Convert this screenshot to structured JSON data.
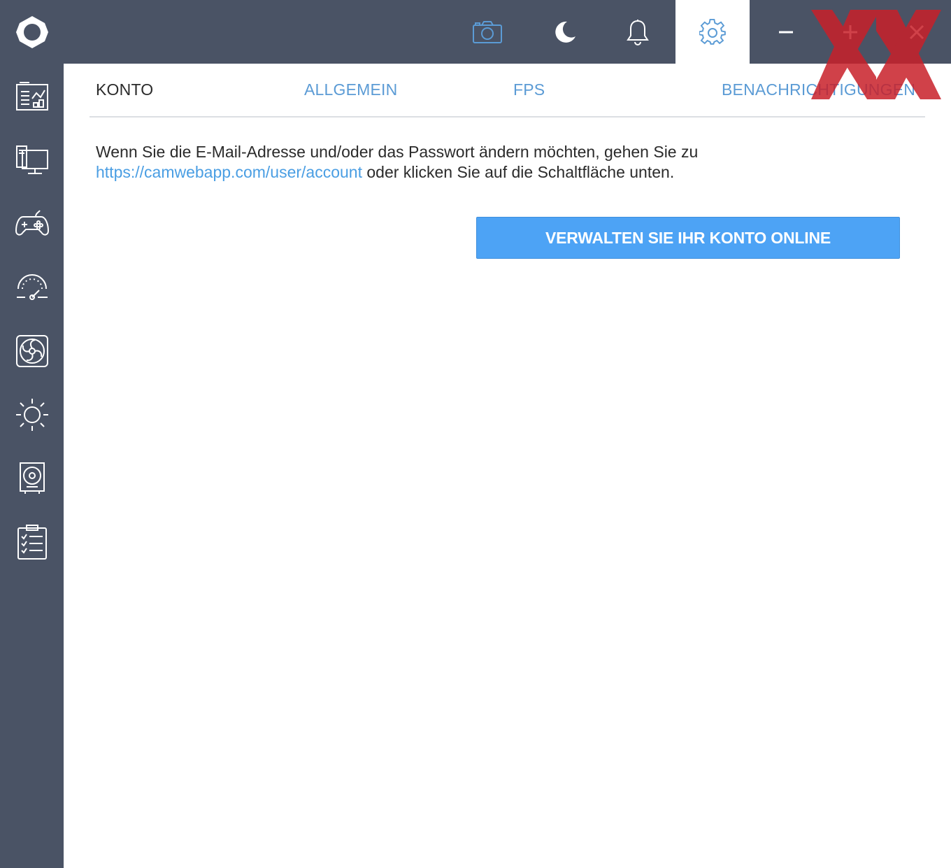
{
  "colors": {
    "chrome": "#4a5365",
    "accent": "#4da3f5",
    "link": "#4a9ee3",
    "active_tab_text": "#2b2b2b",
    "watermark": "#c8202a"
  },
  "topbar": {
    "logo_icon": "app-logo-icon",
    "icons": [
      {
        "name": "camera-icon"
      },
      {
        "name": "moon-icon"
      },
      {
        "name": "bell-icon"
      },
      {
        "name": "gear-icon",
        "active": true
      },
      {
        "name": "minimize-icon"
      },
      {
        "name": "maximize-icon"
      },
      {
        "name": "close-icon"
      }
    ]
  },
  "sidebar": {
    "items": [
      {
        "icon": "dashboard-icon"
      },
      {
        "icon": "monitor-icon"
      },
      {
        "icon": "gamepad-icon"
      },
      {
        "icon": "speedometer-icon"
      },
      {
        "icon": "fan-icon"
      },
      {
        "icon": "brightness-icon"
      },
      {
        "icon": "speaker-icon"
      },
      {
        "icon": "checklist-icon"
      }
    ]
  },
  "tabs": [
    {
      "label": "KONTO",
      "active": true
    },
    {
      "label": "ALLGEMEIN",
      "active": false
    },
    {
      "label": "FPS",
      "active": false
    },
    {
      "label": "BENACHRICHTIGUNGEN",
      "active": false
    }
  ],
  "account": {
    "text_before": "Wenn Sie die E-Mail-Adresse und/oder das Passwort ändern möchten, gehen Sie zu",
    "link": "https://camwebapp.com/user/account",
    "text_after": " oder klicken Sie auf die Schaltfläche unten.",
    "button_label": "VERWALTEN SIE IHR KONTO ONLINE"
  },
  "watermark_text": "XX"
}
